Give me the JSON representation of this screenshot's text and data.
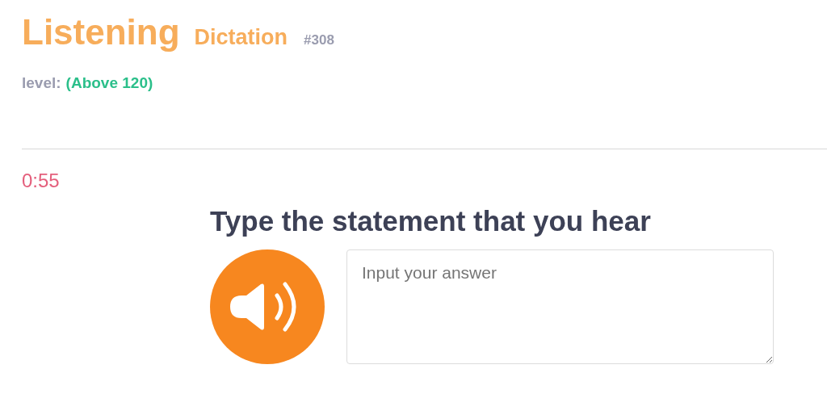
{
  "header": {
    "title": "Listening",
    "subtitle": "Dictation",
    "number": "#308"
  },
  "level": {
    "label": "level:",
    "value": "(Above 120)"
  },
  "timer": "0:55",
  "question": {
    "prompt": "Type the statement that you hear",
    "answer": {
      "placeholder": "Input your answer"
    }
  }
}
